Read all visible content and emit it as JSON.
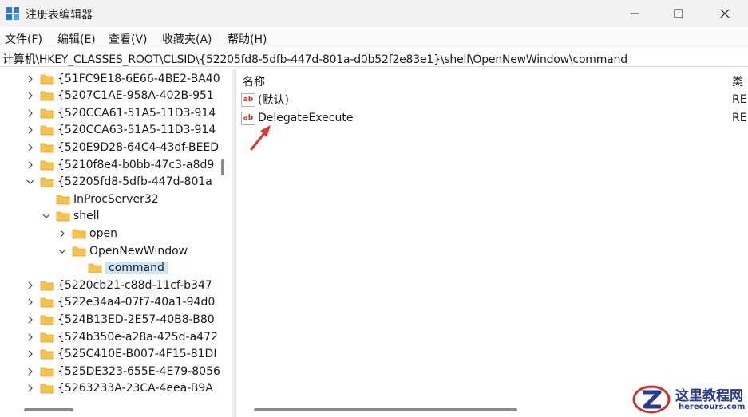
{
  "window": {
    "title": "注册表编辑器"
  },
  "menu": [
    "文件(F)",
    "编辑(E)",
    "查看(V)",
    "收藏夹(A)",
    "帮助(H)"
  ],
  "address": "计算机\\HKEY_CLASSES_ROOT\\CLSID\\{52205fd8-5dfb-447d-801a-d0b52f2e83e1}\\shell\\OpenNewWindow\\command",
  "tree": [
    {
      "label": "{51FC9E18-6E66-4BE2-BA40",
      "state": "collapsed"
    },
    {
      "label": "{5207C1AE-958A-402B-951",
      "state": "collapsed"
    },
    {
      "label": "{520CCA61-51A5-11D3-914",
      "state": "collapsed"
    },
    {
      "label": "{520CCA63-51A5-11D3-914",
      "state": "collapsed"
    },
    {
      "label": "{520E9D28-64C4-43df-BEED",
      "state": "collapsed"
    },
    {
      "label": "{5210f8e4-b0bb-47c3-a8d9",
      "state": "collapsed"
    },
    {
      "label": "{52205fd8-5dfb-447d-801a",
      "state": "expanded"
    },
    {
      "label": "InProcServer32",
      "state": "leaf"
    },
    {
      "label": "shell",
      "state": "expanded"
    },
    {
      "label": "open",
      "state": "collapsed"
    },
    {
      "label": "OpenNewWindow",
      "state": "expanded"
    },
    {
      "label": "command",
      "state": "selected"
    },
    {
      "label": "{5220cb21-c88d-11cf-b347",
      "state": "collapsed"
    },
    {
      "label": "{522e34a4-07f7-40a1-94d0",
      "state": "collapsed"
    },
    {
      "label": "{524B13ED-2E57-40B8-B80",
      "state": "collapsed"
    },
    {
      "label": "{524b350e-a28a-425d-a472",
      "state": "collapsed"
    },
    {
      "label": "{525C410E-B007-4F15-81DI",
      "state": "collapsed"
    },
    {
      "label": "{525DE323-655E-4E79-8056",
      "state": "collapsed"
    },
    {
      "label": "{5263233A-23CA-4eea-B9A",
      "state": "collapsed"
    }
  ],
  "values_pane": {
    "header_name": "名称",
    "header_type": "类",
    "rows": [
      {
        "name": "(默认)",
        "type": "RE",
        "icon": "string-value-icon"
      },
      {
        "name": "DelegateExecute",
        "type": "RE",
        "icon": "string-value-icon"
      }
    ]
  },
  "watermark": {
    "title": "这里教程网",
    "url": "herecours.com"
  },
  "colors": {
    "selection": "#cce4f7",
    "folder": "#f4c24d",
    "annotation_arrow": "#e0352b",
    "watermark": "#2a3a8c"
  }
}
